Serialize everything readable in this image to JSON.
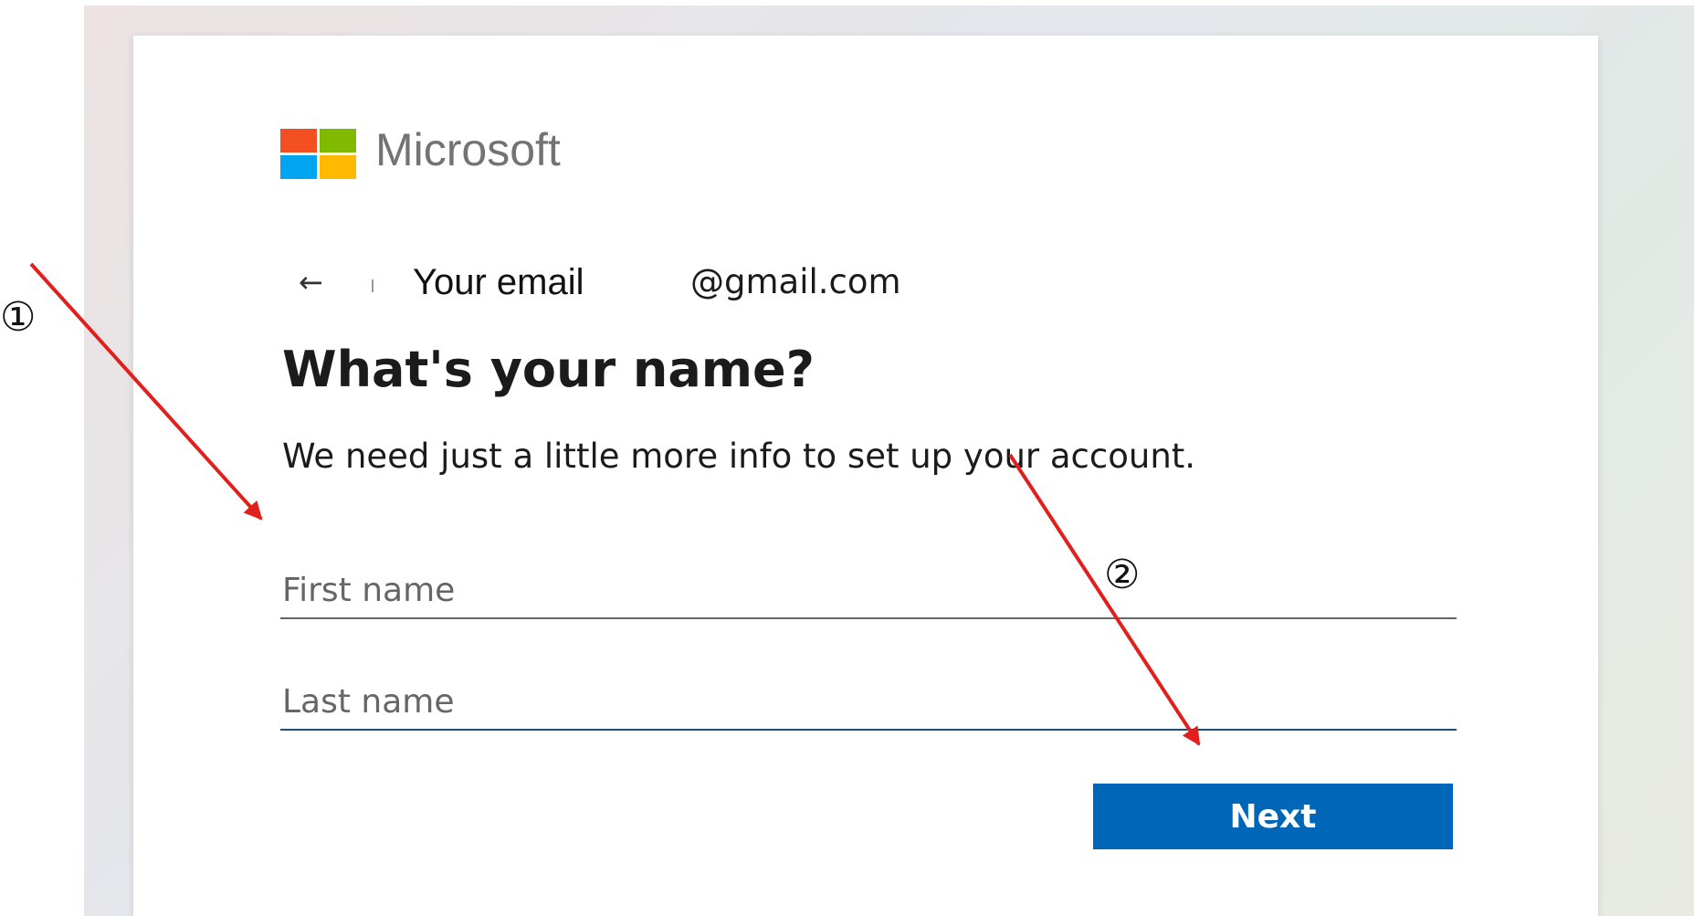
{
  "brand": {
    "name": "Microsoft",
    "colors": {
      "red": "#f25022",
      "green": "#7fba00",
      "blue": "#00a4ef",
      "yellow": "#ffb900"
    }
  },
  "identity": {
    "back_icon": "left-arrow-icon",
    "email_label": "Your email",
    "email_domain": "@gmail.com"
  },
  "heading": "What's your name?",
  "subheading": "We need just a little more info to set up your account.",
  "form": {
    "first_name": {
      "placeholder": "First name",
      "value": ""
    },
    "last_name": {
      "placeholder": "Last name",
      "value": ""
    }
  },
  "next_button": {
    "label": "Next",
    "color": "#0067b8"
  },
  "annotations": {
    "marker_1": "①",
    "marker_2": "②",
    "arrow_color": "#e0201c"
  }
}
